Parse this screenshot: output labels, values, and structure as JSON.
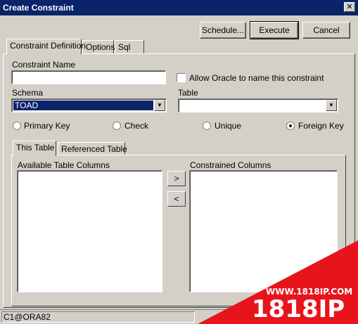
{
  "window": {
    "title": "Create Constraint",
    "close_glyph": "✕"
  },
  "buttons": {
    "schedule": "Schedule...",
    "execute": "Execute",
    "cancel": "Cancel"
  },
  "tabs": [
    {
      "label": "Constraint Definition",
      "active": true
    },
    {
      "label": "Options",
      "active": false
    },
    {
      "label": "Sql",
      "active": false
    }
  ],
  "form": {
    "constraint_name_label": "Constraint Name",
    "constraint_name_value": "",
    "allow_oracle_label": "Allow Oracle to name this constraint",
    "allow_oracle_checked": false,
    "schema_label": "Schema",
    "schema_value": "TOAD",
    "table_label": "Table",
    "table_value": ""
  },
  "constraint_types": [
    {
      "label": "Primary Key",
      "selected": false
    },
    {
      "label": "Check",
      "selected": false
    },
    {
      "label": "Unique",
      "selected": false
    },
    {
      "label": "Foreign Key",
      "selected": true
    }
  ],
  "inner_tabs": [
    {
      "label": "This Table",
      "active": true
    },
    {
      "label": "Referenced Table",
      "active": false
    }
  ],
  "columns": {
    "available_label": "Available Table Columns",
    "constrained_label": "Constrained Columns",
    "move_right": ">",
    "move_left": "<"
  },
  "status": {
    "connection": "C1@ORA82"
  },
  "watermark": {
    "url": "WWW.1818IP.COM",
    "brand": "1818IP"
  }
}
